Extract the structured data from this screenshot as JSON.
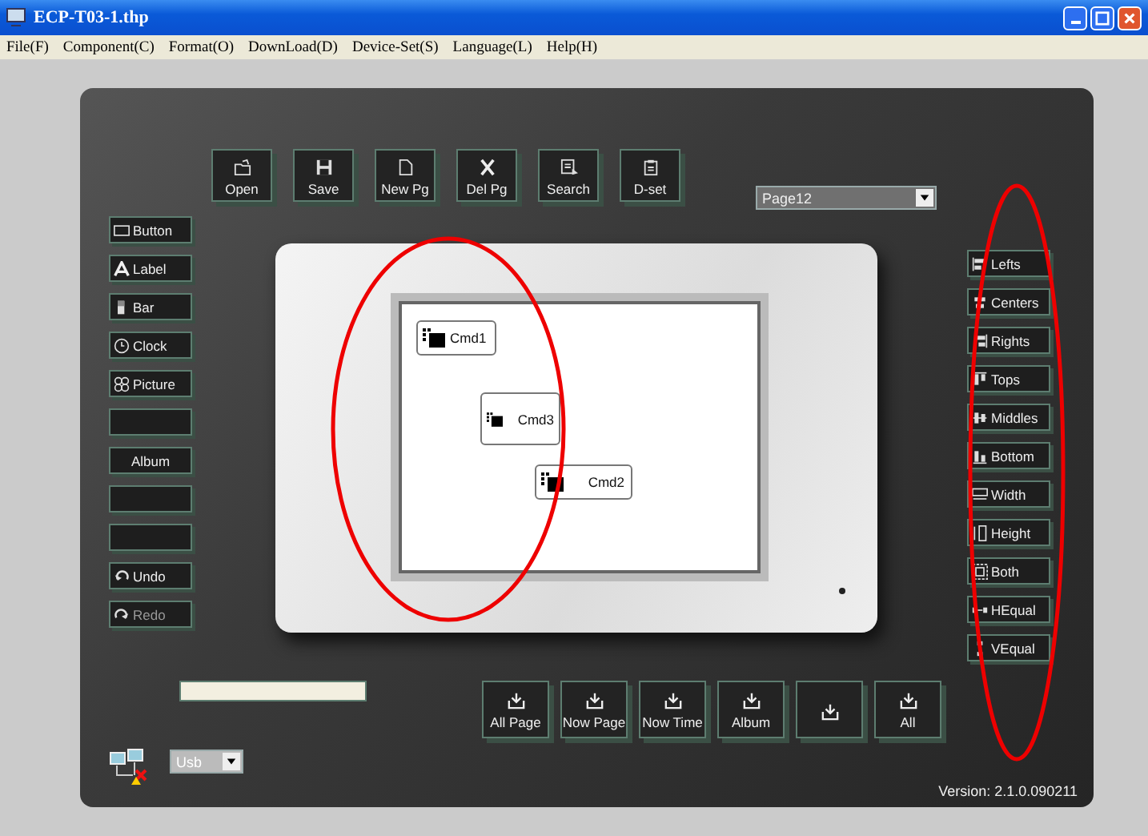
{
  "window": {
    "title": "ECP-T03-1.thp"
  },
  "menu": [
    "File(F)",
    "Component(C)",
    "Format(O)",
    "DownLoad(D)",
    "Device-Set(S)",
    "Language(L)",
    "Help(H)"
  ],
  "toolbar": [
    {
      "label": "Open"
    },
    {
      "label": "Save"
    },
    {
      "label": "New Pg"
    },
    {
      "label": "Del Pg"
    },
    {
      "label": "Search"
    },
    {
      "label": "D-set"
    }
  ],
  "page_select": {
    "value": "Page12"
  },
  "tools": [
    {
      "kind": "tool",
      "label": "Button",
      "disabled": false
    },
    {
      "kind": "tool",
      "label": "Label",
      "disabled": false
    },
    {
      "kind": "tool",
      "label": "Bar",
      "disabled": false
    },
    {
      "kind": "tool",
      "label": "Clock",
      "disabled": false
    },
    {
      "kind": "tool",
      "label": "Picture",
      "disabled": false
    },
    {
      "kind": "blank"
    },
    {
      "kind": "text",
      "label": "Album",
      "disabled": false
    },
    {
      "kind": "blank"
    },
    {
      "kind": "blank"
    },
    {
      "kind": "tool",
      "label": "Undo",
      "disabled": false
    },
    {
      "kind": "tool",
      "label": "Redo",
      "disabled": true
    }
  ],
  "screen": {
    "buttons": [
      {
        "label": "Cmd1"
      },
      {
        "label": "Cmd3"
      },
      {
        "label": "Cmd2"
      }
    ]
  },
  "align": [
    {
      "label": "Lefts"
    },
    {
      "label": "Centers"
    },
    {
      "label": "Rights"
    },
    {
      "label": "Tops"
    },
    {
      "label": "Middles"
    },
    {
      "label": "Bottom"
    },
    {
      "label": "Width"
    },
    {
      "label": "Height"
    },
    {
      "label": "Both"
    },
    {
      "label": "HEqual"
    },
    {
      "label": "VEqual"
    }
  ],
  "download": [
    {
      "kind": "labeled",
      "label": "All Page"
    },
    {
      "kind": "labeled",
      "label": "Now Page"
    },
    {
      "kind": "labeled",
      "label": "Now Time"
    },
    {
      "kind": "labeled",
      "label": "Album"
    },
    {
      "kind": "blank"
    },
    {
      "kind": "labeled",
      "label": "All"
    }
  ],
  "port_select": {
    "value": "Usb"
  },
  "version": "Version: 2.1.0.090211"
}
